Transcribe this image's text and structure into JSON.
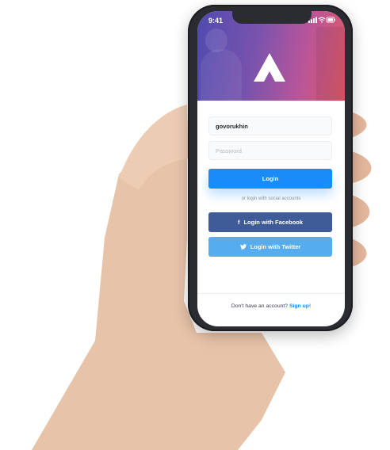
{
  "status_bar": {
    "time": "9:41"
  },
  "login_form": {
    "username_value": "govorukhin",
    "password_placeholder": "Password",
    "login_label": "Login",
    "social_caption": "or login with social accounts",
    "facebook_label": "Login with Facebook",
    "twitter_label": "Login with Twitter"
  },
  "footer": {
    "prompt": "Don't have an account?",
    "signup_link": "Sign up!"
  },
  "colors": {
    "primary": "#1a8cfa",
    "facebook": "#3f5b98",
    "twitter": "#55acee"
  },
  "icons": {
    "app_logo": "triangle-logo-icon",
    "facebook": "facebook-icon",
    "twitter": "twitter-icon",
    "signal": "signal-icon",
    "wifi": "wifi-icon",
    "battery": "battery-icon"
  }
}
